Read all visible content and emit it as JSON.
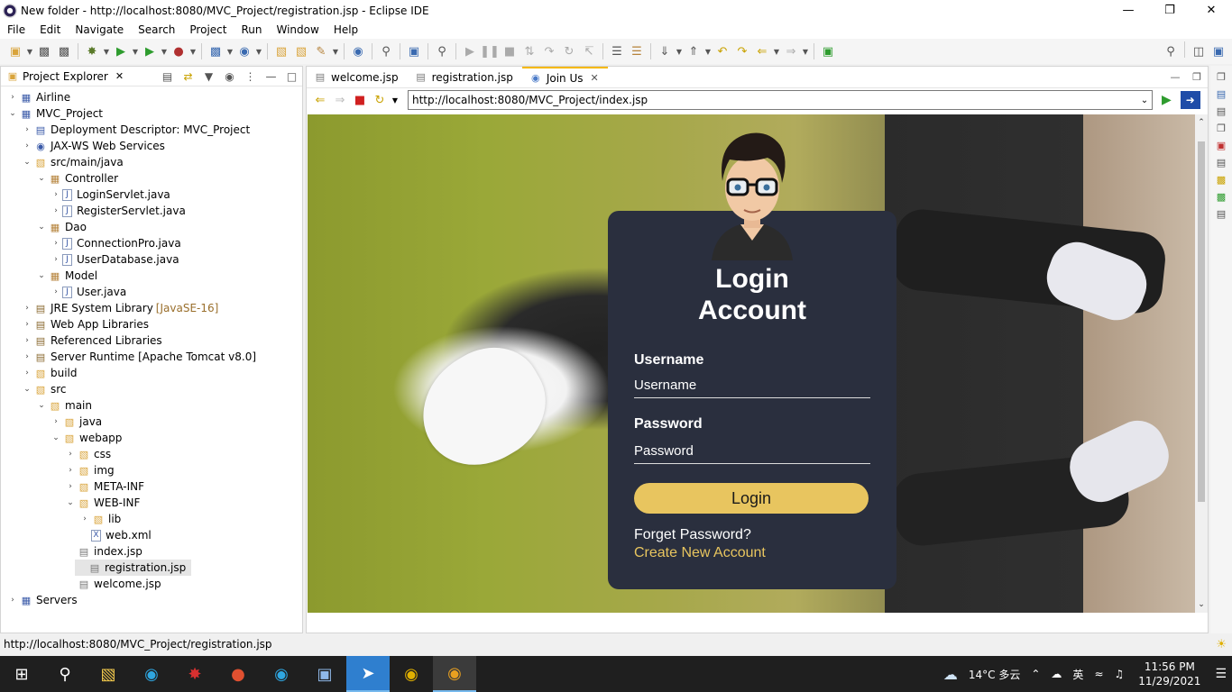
{
  "window": {
    "title": "New folder - http://localhost:8080/MVC_Project/registration.jsp - Eclipse IDE"
  },
  "menu": [
    "File",
    "Edit",
    "Navigate",
    "Search",
    "Project",
    "Run",
    "Window",
    "Help"
  ],
  "explorer": {
    "tab_label": "Project Explorer",
    "items": [
      {
        "label": "Airline",
        "decor": ""
      },
      {
        "label": "MVC_Project",
        "decor": ""
      },
      {
        "label": "Deployment Descriptor: MVC_Project",
        "decor": ""
      },
      {
        "label": "JAX-WS Web Services",
        "decor": ""
      },
      {
        "label": "src/main/java",
        "decor": ""
      },
      {
        "label": "Controller",
        "decor": ""
      },
      {
        "label": "LoginServlet.java",
        "decor": ""
      },
      {
        "label": "RegisterServlet.java",
        "decor": ""
      },
      {
        "label": "Dao",
        "decor": ""
      },
      {
        "label": "ConnectionPro.java",
        "decor": ""
      },
      {
        "label": "UserDatabase.java",
        "decor": ""
      },
      {
        "label": "Model",
        "decor": ""
      },
      {
        "label": "User.java",
        "decor": ""
      },
      {
        "label": "JRE System Library",
        "decor": "[JavaSE-16]"
      },
      {
        "label": "Web App Libraries",
        "decor": ""
      },
      {
        "label": "Referenced Libraries",
        "decor": ""
      },
      {
        "label": "Server Runtime [Apache Tomcat v8.0]",
        "decor": ""
      },
      {
        "label": "build",
        "decor": ""
      },
      {
        "label": "src",
        "decor": ""
      },
      {
        "label": "main",
        "decor": ""
      },
      {
        "label": "java",
        "decor": ""
      },
      {
        "label": "webapp",
        "decor": ""
      },
      {
        "label": "css",
        "decor": ""
      },
      {
        "label": "img",
        "decor": ""
      },
      {
        "label": "META-INF",
        "decor": ""
      },
      {
        "label": "WEB-INF",
        "decor": ""
      },
      {
        "label": "lib",
        "decor": ""
      },
      {
        "label": "web.xml",
        "decor": ""
      },
      {
        "label": "index.jsp",
        "decor": ""
      },
      {
        "label": "registration.jsp",
        "decor": ""
      },
      {
        "label": "welcome.jsp",
        "decor": ""
      },
      {
        "label": "Servers",
        "decor": ""
      }
    ]
  },
  "editor": {
    "tabs": [
      "welcome.jsp",
      "registration.jsp",
      "Join Us"
    ],
    "url": "http://localhost:8080/MVC_Project/index.jsp"
  },
  "login": {
    "title_line1": "Login",
    "title_line2": "Account",
    "username_label": "Username",
    "username_placeholder": "Username",
    "password_label": "Password",
    "password_placeholder": "Password",
    "button": "Login",
    "forget": "Forget Password?",
    "create": "Create New Account"
  },
  "status": {
    "text": "http://localhost:8080/MVC_Project/registration.jsp"
  },
  "taskbar": {
    "weather": "14°C 多云",
    "ime": "英",
    "time": "11:56 PM",
    "date": "11/29/2021"
  }
}
